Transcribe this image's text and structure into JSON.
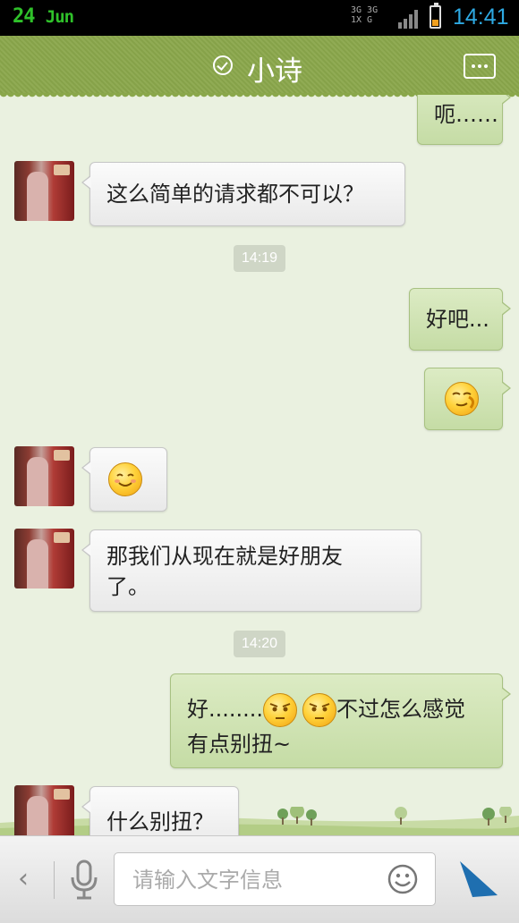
{
  "status_bar": {
    "date_day": "24",
    "date_month": "Jun",
    "network_top": "3G 3G 1X G",
    "time": "14:41"
  },
  "header": {
    "title": "小诗",
    "verified_icon": "check-circle-icon",
    "menu_icon": "more-icon"
  },
  "messages": [
    {
      "side": "out",
      "text": "呃……"
    },
    {
      "side": "in",
      "text": "这么简单的请求都不可以？"
    },
    {
      "time": "14:19"
    },
    {
      "side": "out",
      "text": "好吧..."
    },
    {
      "side": "out",
      "emoji": "shy-emoji"
    },
    {
      "side": "in",
      "emoji": "smile-emoji"
    },
    {
      "side": "in",
      "text_line1": "那我们从现在就是好朋友",
      "text_line2": "了。"
    },
    {
      "time": "14:20"
    },
    {
      "side": "out",
      "text_a": "好........",
      "text_b": "不过怎么感觉",
      "text_line2": "有点别扭~",
      "emoji": "squint-emoji"
    },
    {
      "side": "in",
      "text": "什么别扭？"
    }
  ],
  "composer": {
    "placeholder": "请输入文字信息",
    "back_label": "‹"
  },
  "colors": {
    "header_bg": "#8aa74b",
    "chat_bg": "#eaf1e0",
    "out_bubble": "#cfe3b4",
    "in_bubble": "#f5f5f5",
    "time_color": "#2ea9e2",
    "date_color": "#2fc12a"
  }
}
